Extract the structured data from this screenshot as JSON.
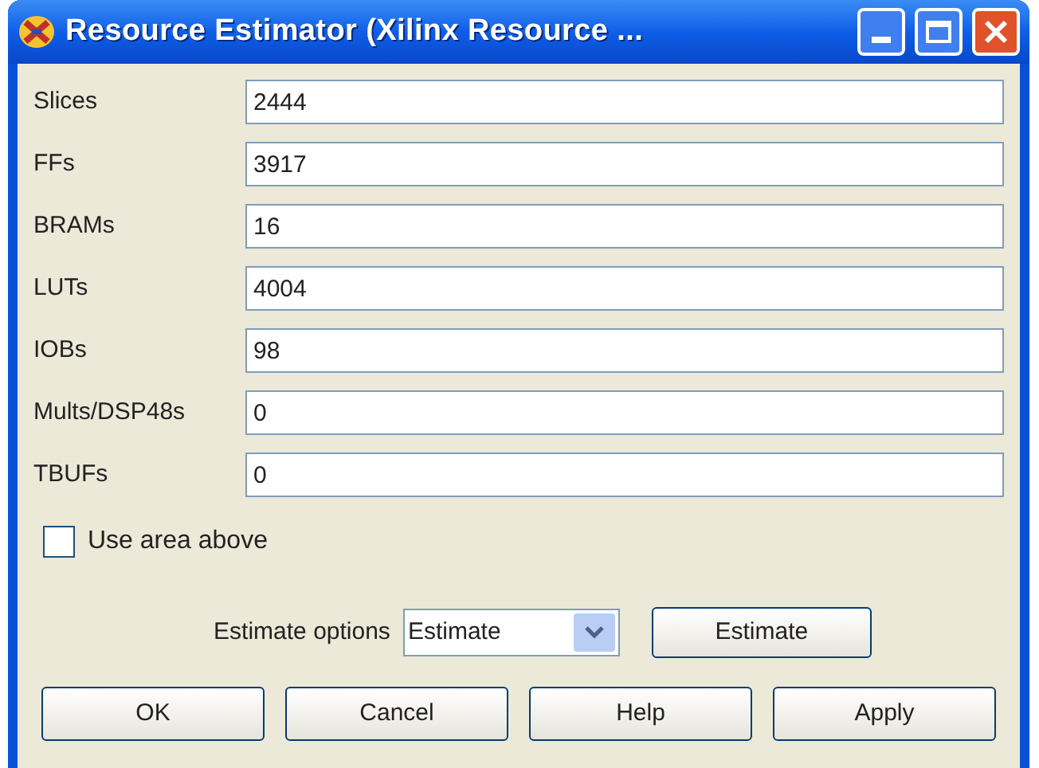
{
  "window": {
    "title": "Resource Estimator (Xilinx Resource ..."
  },
  "fields": [
    {
      "label": "Slices",
      "value": "2444"
    },
    {
      "label": "FFs",
      "value": "3917"
    },
    {
      "label": "BRAMs",
      "value": "16"
    },
    {
      "label": "LUTs",
      "value": "4004"
    },
    {
      "label": "IOBs",
      "value": "98"
    },
    {
      "label": "Mults/DSP48s",
      "value": "0"
    },
    {
      "label": "TBUFs",
      "value": "0"
    }
  ],
  "use_area_above": {
    "label": "Use area above",
    "checked": false
  },
  "estimate_options": {
    "label": "Estimate options",
    "value": "Estimate",
    "button": "Estimate"
  },
  "buttons": [
    "OK",
    "Cancel",
    "Help",
    "Apply"
  ]
}
